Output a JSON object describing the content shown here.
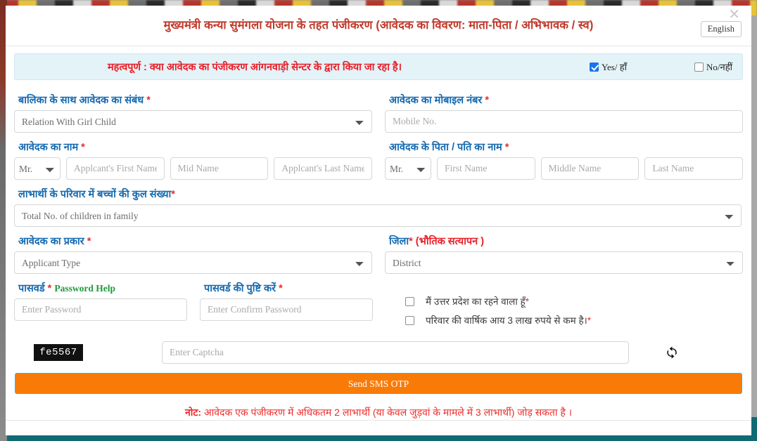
{
  "modal": {
    "title": "मुख्यमंत्री कन्या सुमंगला योजना के तहत पंजीकरण (आवेदक का विवरण: माता-पिता / अभिभावक / स्व)",
    "close_icon": "close-icon",
    "language_button": "English"
  },
  "notice": {
    "prefix": "महत्वपूर्ण",
    "text": " : क्या आवेदक का पंजीकरण आंगनवाड़ी सेन्टर के द्वारा किया जा रहा है।",
    "yes_label": "Yes/ हाँ",
    "no_label": "No/नहीं",
    "yes_checked": true,
    "no_checked": false
  },
  "fields": {
    "relation": {
      "label": "बालिका के साथ आवेदक का संबंध ",
      "required": "*",
      "value": "Relation With Girl Child"
    },
    "mobile": {
      "label": "आवेदक का मोबाइल नंबर ",
      "required": "*",
      "placeholder": "Mobile No.",
      "value": ""
    },
    "applicant_name": {
      "label": "आवेदक का नाम ",
      "required": "*",
      "title_value": "Mr.",
      "first_placeholder": "Applcant's First Name",
      "mid_placeholder": "Mid Name",
      "last_placeholder": "Applcant's Last Name"
    },
    "father_name": {
      "label": "आवेदक के पिता / पति का नाम ",
      "required": "*",
      "title_value": "Mr.",
      "first_placeholder": "First Name",
      "mid_placeholder": "Middle Name",
      "last_placeholder": "Last Name"
    },
    "children_count": {
      "label": "लाभार्थी के परिवार में बच्चों की कुल संख्या",
      "required": "*",
      "value": "Total No. of children in family"
    },
    "applicant_type": {
      "label": "आवेदक का प्रकार ",
      "required": "*",
      "value": "Applicant Type"
    },
    "district": {
      "label": "जिला",
      "required": "*",
      "sub_label": " (भौतिक सत्यापन )",
      "value": "District"
    },
    "password": {
      "label": "पासवर्ड ",
      "required": "*",
      "help": "Password Help",
      "placeholder": "Enter Password",
      "value": ""
    },
    "confirm_password": {
      "label": "पासवर्ड की पुष्टि करें ",
      "required": "*",
      "placeholder": "Enter Confirm Password",
      "value": ""
    }
  },
  "declarations": [
    {
      "text": "मैं उत्तर प्रदेश का रहने वाला हूँ",
      "required": "*",
      "checked": false
    },
    {
      "text": "परिवार की वार्षिक आय 3 लाख रुपये से कम है।",
      "required": "*",
      "checked": false
    }
  ],
  "captcha": {
    "code": "fe5567",
    "placeholder": "Enter Captcha",
    "value": "",
    "refresh_icon": "refresh-icon"
  },
  "submit": {
    "label": "Send SMS OTP"
  },
  "note": {
    "prefix": "नोट:",
    "text": " आवेदक एक पंजीकरण में अधिकतम 2 लाभार्थी (या केवल जुड़वां के मामले में 3 लाभार्थी) जोड़ सकता है ।"
  },
  "colors": {
    "title_red": "#c0392b",
    "label_blue": "#1469b0",
    "notice_bg": "#e3f3f8",
    "notice_red": "#e8202a",
    "help_green": "#1f9a3c",
    "submit_orange": "#f97b07",
    "submit_border": "#4cb0c6",
    "checkbox_blue": "#1a73e8"
  }
}
